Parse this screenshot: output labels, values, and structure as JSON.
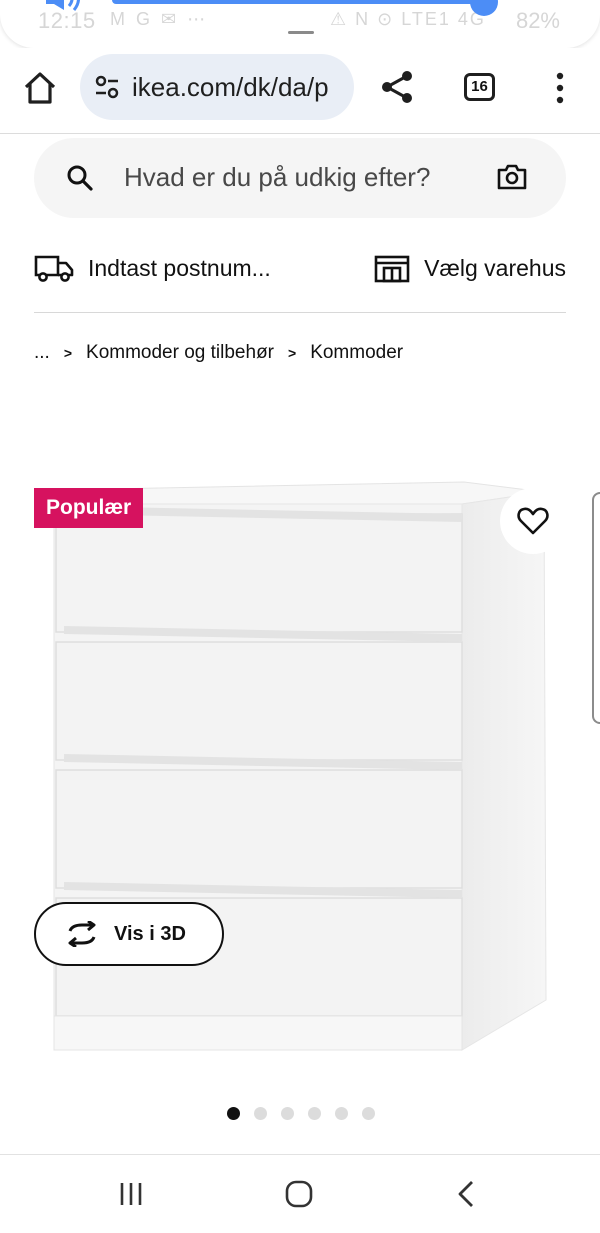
{
  "status_bar": {
    "time": "12:15",
    "indicators": "M G ✉ ⋯",
    "network": "⚠ N ⊙ LTE1 4G",
    "battery": "82%"
  },
  "browser": {
    "url": "ikea.com/dk/da/p",
    "tab_count": "16"
  },
  "search": {
    "placeholder": "Hvad er du på udkig efter?"
  },
  "delivery": {
    "postcode_label": "Indtast postnum...",
    "store_label": "Vælg varehus"
  },
  "breadcrumb": {
    "items": [
      "...",
      "Kommoder og tilbehør",
      "Kommoder"
    ]
  },
  "product": {
    "badge": "Populær",
    "view_3d_label": "Vis i 3D",
    "image_count": 6,
    "active_image": 1
  },
  "colors": {
    "badge_bg": "#d6125f",
    "volume_accent": "#4c8df6",
    "url_pill_bg": "#e9eef6"
  }
}
